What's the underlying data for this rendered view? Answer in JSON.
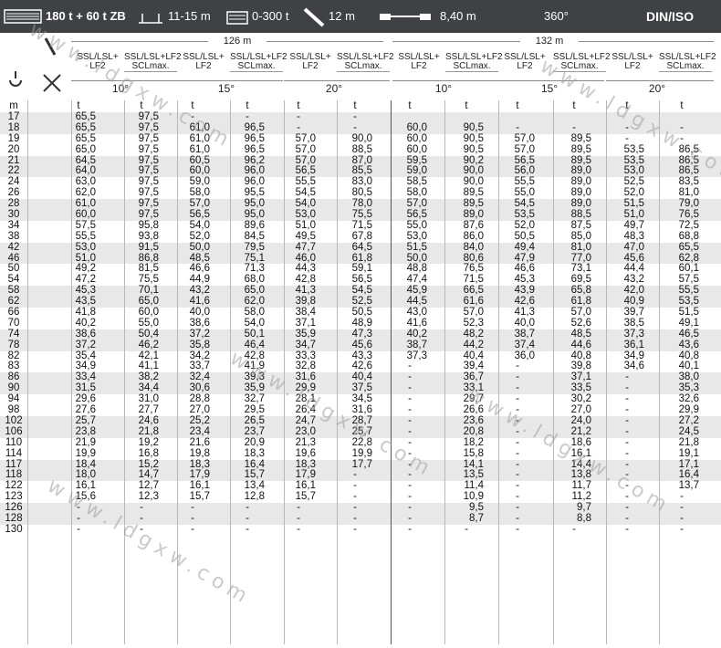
{
  "topbar": {
    "counterweight": "180 t + 60 t ZB",
    "pad": "11-15 m",
    "load": "0-300 t",
    "boom": "12 m",
    "width": "8,40 m",
    "slew": "360°",
    "norm": "DIN/ISO"
  },
  "header": {
    "main_boom_a": "126 m",
    "main_boom_b": "132 m",
    "col_a": "SSL/LSL+LF2",
    "col_b": "SSL/LSL+LF2 SCLmax.",
    "angles": [
      "10°",
      "15°",
      "20°",
      "10°",
      "15°",
      "20°"
    ],
    "unit_m": "m",
    "unit_t": "t"
  },
  "rows": [
    [
      "17",
      "65,5",
      "97,5",
      "-",
      "-",
      "-",
      "-",
      "",
      "",
      "",
      "",
      "",
      ""
    ],
    [
      "18",
      "65,5",
      "97,5",
      "61,0",
      "96,5",
      "-",
      "-",
      "60,0",
      "90,5",
      "-",
      "-",
      "-",
      "-"
    ],
    [
      "19",
      "65,5",
      "97,5",
      "61,0",
      "96,5",
      "57,0",
      "90,0",
      "60,0",
      "90,5",
      "57,0",
      "89,5",
      "-",
      "-"
    ],
    [
      "20",
      "65,0",
      "97,5",
      "61,0",
      "96,5",
      "57,0",
      "88,5",
      "60,0",
      "90,5",
      "57,0",
      "89,5",
      "53,5",
      "86,5"
    ],
    [
      "21",
      "64,5",
      "97,5",
      "60,5",
      "96,2",
      "57,0",
      "87,0",
      "59,5",
      "90,2",
      "56,5",
      "89,5",
      "53,5",
      "86,5"
    ],
    [
      "22",
      "64,0",
      "97,5",
      "60,0",
      "96,0",
      "56,5",
      "85,5",
      "59,0",
      "90,0",
      "56,0",
      "89,0",
      "53,0",
      "86,5"
    ],
    [
      "24",
      "63,0",
      "97,5",
      "59,0",
      "96,0",
      "55,5",
      "83,0",
      "58,5",
      "90,0",
      "55,5",
      "89,0",
      "52,5",
      "83,5"
    ],
    [
      "26",
      "62,0",
      "97,5",
      "58,0",
      "95,5",
      "54,5",
      "80,5",
      "58,0",
      "89,5",
      "55,0",
      "89,0",
      "52,0",
      "81,0"
    ],
    [
      "28",
      "61,0",
      "97,5",
      "57,0",
      "95,0",
      "54,0",
      "78,0",
      "57,0",
      "89,5",
      "54,5",
      "89,0",
      "51,5",
      "79,0"
    ],
    [
      "30",
      "60,0",
      "97,5",
      "56,5",
      "95,0",
      "53,0",
      "75,5",
      "56,5",
      "89,0",
      "53,5",
      "88,5",
      "51,0",
      "76,5"
    ],
    [
      "34",
      "57,5",
      "95,8",
      "54,0",
      "89,6",
      "51,0",
      "71,5",
      "55,0",
      "87,6",
      "52,0",
      "87,5",
      "49,7",
      "72,5"
    ],
    [
      "38",
      "55,5",
      "93,8",
      "52,0",
      "84,5",
      "49,5",
      "67,8",
      "53,0",
      "86,0",
      "50,5",
      "85,0",
      "48,3",
      "68,8"
    ],
    [
      "42",
      "53,0",
      "91,5",
      "50,0",
      "79,5",
      "47,7",
      "64,5",
      "51,5",
      "84,0",
      "49,4",
      "81,0",
      "47,0",
      "65,5"
    ],
    [
      "46",
      "51,0",
      "86,8",
      "48,5",
      "75,1",
      "46,0",
      "61,8",
      "50,0",
      "80,6",
      "47,9",
      "77,0",
      "45,6",
      "62,8"
    ],
    [
      "50",
      "49,2",
      "81,5",
      "46,6",
      "71,3",
      "44,3",
      "59,1",
      "48,8",
      "76,5",
      "46,6",
      "73,1",
      "44,4",
      "60,1"
    ],
    [
      "54",
      "47,2",
      "75,5",
      "44,9",
      "68,0",
      "42,8",
      "56,5",
      "47,4",
      "71,5",
      "45,3",
      "69,5",
      "43,2",
      "57,5"
    ],
    [
      "58",
      "45,3",
      "70,1",
      "43,2",
      "65,0",
      "41,3",
      "54,5",
      "45,9",
      "66,5",
      "43,9",
      "65,8",
      "42,0",
      "55,5"
    ],
    [
      "62",
      "43,5",
      "65,0",
      "41,6",
      "62,0",
      "39,8",
      "52,5",
      "44,5",
      "61,6",
      "42,6",
      "61,8",
      "40,9",
      "53,5"
    ],
    [
      "66",
      "41,8",
      "60,0",
      "40,0",
      "58,0",
      "38,4",
      "50,5",
      "43,0",
      "57,0",
      "41,3",
      "57,0",
      "39,7",
      "51,5"
    ],
    [
      "70",
      "40,2",
      "55,0",
      "38,6",
      "54,0",
      "37,1",
      "48,9",
      "41,6",
      "52,3",
      "40,0",
      "52,6",
      "38,5",
      "49,1"
    ],
    [
      "74",
      "38,6",
      "50,4",
      "37,2",
      "50,1",
      "35,9",
      "47,3",
      "40,2",
      "48,2",
      "38,7",
      "48,5",
      "37,3",
      "46,5"
    ],
    [
      "78",
      "37,2",
      "46,2",
      "35,8",
      "46,4",
      "34,7",
      "45,6",
      "38,7",
      "44,2",
      "37,4",
      "44,6",
      "36,1",
      "43,6"
    ],
    [
      "82",
      "35,4",
      "42,1",
      "34,2",
      "42,8",
      "33,3",
      "43,3",
      "37,3",
      "40,4",
      "36,0",
      "40,8",
      "34,9",
      "40,8"
    ],
    [
      "83",
      "34,9",
      "41,1",
      "33,7",
      "41,9",
      "32,8",
      "42,6",
      "-",
      "39,4",
      "-",
      "39,8",
      "34,6",
      "40,1"
    ],
    [
      "86",
      "33,4",
      "38,2",
      "32,4",
      "39,3",
      "31,6",
      "40,4",
      "-",
      "36,7",
      "-",
      "37,1",
      "-",
      "38,0"
    ],
    [
      "90",
      "31,5",
      "34,4",
      "30,6",
      "35,9",
      "29,9",
      "37,5",
      "-",
      "33,1",
      "-",
      "33,5",
      "-",
      "35,3"
    ],
    [
      "94",
      "29,6",
      "31,0",
      "28,8",
      "32,7",
      "28,1",
      "34,5",
      "-",
      "29,7",
      "-",
      "30,2",
      "-",
      "32,6"
    ],
    [
      "98",
      "27,6",
      "27,7",
      "27,0",
      "29,5",
      "26,4",
      "31,6",
      "-",
      "26,6",
      "-",
      "27,0",
      "-",
      "29,9"
    ],
    [
      "102",
      "25,7",
      "24,6",
      "25,2",
      "26,5",
      "24,7",
      "28,7",
      "-",
      "23,6",
      "-",
      "24,0",
      "-",
      "27,2"
    ],
    [
      "106",
      "23,8",
      "21,8",
      "23,4",
      "23,7",
      "23,0",
      "25,7",
      "-",
      "20,8",
      "-",
      "21,2",
      "-",
      "24,5"
    ],
    [
      "110",
      "21,9",
      "19,2",
      "21,6",
      "20,9",
      "21,3",
      "22,8",
      "-",
      "18,2",
      "-",
      "18,6",
      "-",
      "21,8"
    ],
    [
      "114",
      "19,9",
      "16,8",
      "19,8",
      "18,3",
      "19,6",
      "19,9",
      "-",
      "15,8",
      "-",
      "16,1",
      "-",
      "19,1"
    ],
    [
      "117",
      "18,4",
      "15,2",
      "18,3",
      "16,4",
      "18,3",
      "17,7",
      "-",
      "14,1",
      "-",
      "14,4",
      "-",
      "17,1"
    ],
    [
      "118",
      "18,0",
      "14,7",
      "17,9",
      "15,7",
      "17,9",
      "-",
      "-",
      "13,5",
      "-",
      "13,8",
      "-",
      "16,4"
    ],
    [
      "122",
      "16,1",
      "12,7",
      "16,1",
      "13,4",
      "16,1",
      "-",
      "-",
      "11,4",
      "-",
      "11,7",
      "-",
      "13,7"
    ],
    [
      "123",
      "15,6",
      "12,3",
      "15,7",
      "12,8",
      "15,7",
      "-",
      "-",
      "10,9",
      "-",
      "11,2",
      "-",
      "-"
    ],
    [
      "126",
      "-",
      "-",
      "-",
      "-",
      "-",
      "-",
      "-",
      "9,5",
      "-",
      "9,7",
      "-",
      "-"
    ],
    [
      "128",
      "-",
      "-",
      "-",
      "-",
      "-",
      "-",
      "-",
      "8,7",
      "-",
      "8,8",
      "-",
      "-"
    ],
    [
      "130",
      "-",
      "-",
      "-",
      "-",
      "-",
      "-",
      "-",
      "-",
      "-",
      "-",
      "-",
      "-"
    ]
  ],
  "watermark": "www.ldgxw.com",
  "colors": {
    "topbar": "#3f4145",
    "stripe": "#e8e8e8"
  }
}
